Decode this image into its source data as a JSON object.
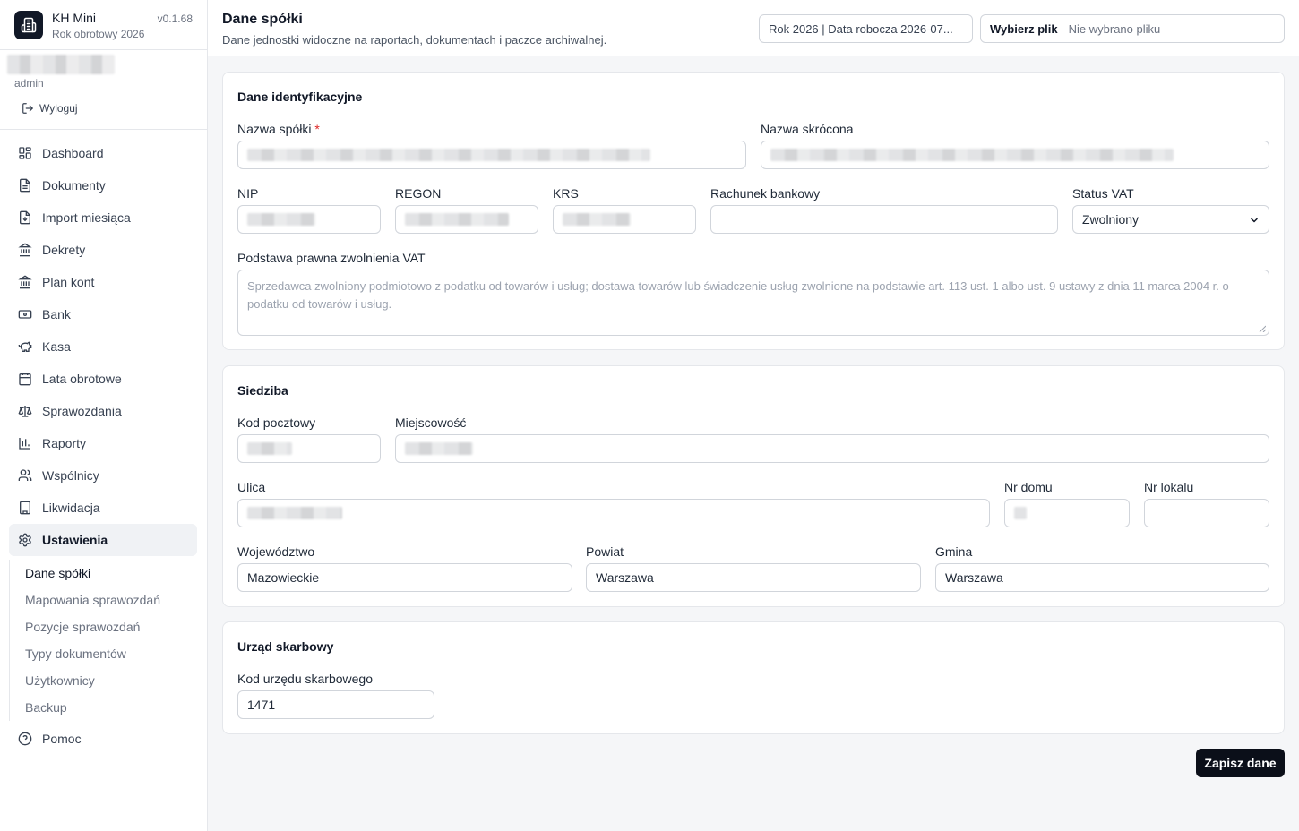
{
  "app": {
    "name": "KH Mini",
    "version": "v0.1.68",
    "fiscal_year": "Rok obrotowy 2026"
  },
  "user": {
    "role": "admin",
    "logout_label": "Wyloguj"
  },
  "nav": {
    "items": [
      {
        "label": "Dashboard",
        "icon": "dashboard-icon"
      },
      {
        "label": "Dokumenty",
        "icon": "document-icon"
      },
      {
        "label": "Import miesiąca",
        "icon": "file-import-icon"
      },
      {
        "label": "Dekrety",
        "icon": "bank-building-icon"
      },
      {
        "label": "Plan kont",
        "icon": "bank-building-icon"
      },
      {
        "label": "Bank",
        "icon": "banknote-icon"
      },
      {
        "label": "Kasa",
        "icon": "piggy-bank-icon"
      },
      {
        "label": "Lata obrotowe",
        "icon": "calendar-icon"
      },
      {
        "label": "Sprawozdania",
        "icon": "scale-icon"
      },
      {
        "label": "Raporty",
        "icon": "bar-chart-icon"
      },
      {
        "label": "Wspólnicy",
        "icon": "users-icon"
      },
      {
        "label": "Likwidacja",
        "icon": "building-icon"
      },
      {
        "label": "Ustawienia",
        "icon": "gear-icon"
      }
    ],
    "settings_sub": [
      "Dane spółki",
      "Mapowania sprawozdań",
      "Pozycje sprawozdań",
      "Typy dokumentów",
      "Użytkownicy",
      "Backup"
    ],
    "help_label": "Pomoc"
  },
  "header": {
    "title": "Dane spółki",
    "subtitle": "Dane jednostki widoczne na raportach, dokumentach i paczce archiwalnej.",
    "year_button": "Rok 2026 | Data robocza 2026-07...",
    "file_button": "Wybierz plik",
    "file_status": "Nie wybrano pliku"
  },
  "identification": {
    "title": "Dane identyfikacyjne",
    "name_label": "Nazwa spółki",
    "required_mark": "*",
    "short_name_label": "Nazwa skrócona",
    "nip_label": "NIP",
    "regon_label": "REGON",
    "krs_label": "KRS",
    "bank_label": "Rachunek bankowy",
    "vat_label": "Status VAT",
    "vat_value": "Zwolniony",
    "legal_basis_label": "Podstawa prawna zwolnienia VAT",
    "legal_basis_placeholder": "Sprzedawca zwolniony podmiotowo z podatku od towarów i usług; dostawa towarów lub świadczenie usług zwolnione na podstawie art. 113 ust. 1 albo ust. 9 ustawy z dnia 11 marca 2004 r. o podatku od towarów i usług."
  },
  "address": {
    "title": "Siedziba",
    "postal_label": "Kod pocztowy",
    "city_label": "Miejscowość",
    "street_label": "Ulica",
    "house_label": "Nr domu",
    "flat_label": "Nr lokalu",
    "voivodeship_label": "Województwo",
    "voivodeship_value": "Mazowieckie",
    "county_label": "Powiat",
    "county_value": "Warszawa",
    "commune_label": "Gmina",
    "commune_value": "Warszawa"
  },
  "tax_office": {
    "title": "Urząd skarbowy",
    "code_label": "Kod urzędu skarbowego",
    "code_value": "1471"
  },
  "actions": {
    "save_label": "Zapisz dane"
  }
}
